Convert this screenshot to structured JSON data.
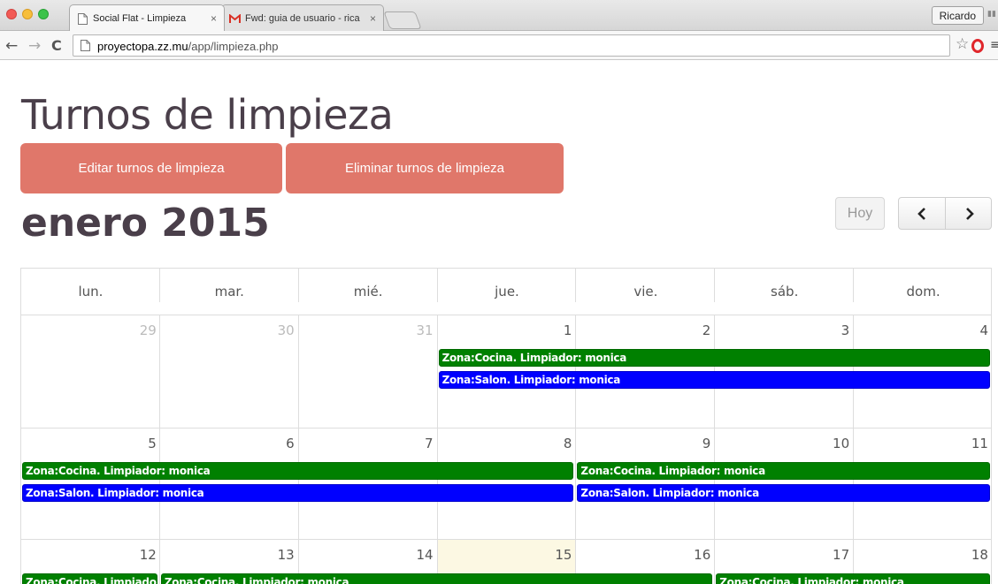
{
  "browser": {
    "tabs": [
      {
        "title": "Social Flat - Limpieza",
        "close": "×"
      },
      {
        "title": "Fwd: guia de usuario - rica",
        "close": "×"
      }
    ],
    "profile": "Ricardo",
    "url_host": "proyectopa.zz.mu",
    "url_path": "/app/limpieza.php",
    "nav_back": "←",
    "nav_forward": "→",
    "nav_reload": "C",
    "star_icon": "☆",
    "menu_icon": "≡"
  },
  "page": {
    "title": "Turnos de limpieza",
    "edit_button": "Editar turnos de limpieza",
    "delete_button": "Eliminar turnos de limpieza",
    "month": "enero 2015",
    "today_button": "Hoy",
    "prev_icon": "‹",
    "next_icon": "›",
    "button_color": "#e0776a",
    "cocina_color": "#008000",
    "salon_color": "#0000ff",
    "today_color": "#fcf8e3"
  },
  "calendar": {
    "weekdays": [
      "lun.",
      "mar.",
      "mié.",
      "jue.",
      "vie.",
      "sáb.",
      "dom."
    ],
    "weeks": [
      {
        "days": [
          "29",
          "30",
          "31",
          "1",
          "2",
          "3",
          "4"
        ],
        "other_month": [
          true,
          true,
          true,
          false,
          false,
          false,
          false
        ],
        "today": -1,
        "events": [
          {
            "label": "Zona:Cocina. Limpiador: monica",
            "type": "cocina",
            "start": 3,
            "end": 6,
            "lane": 0
          },
          {
            "label": "Zona:Salon. Limpiador: monica",
            "type": "salon",
            "start": 3,
            "end": 6,
            "lane": 1
          }
        ]
      },
      {
        "days": [
          "5",
          "6",
          "7",
          "8",
          "9",
          "10",
          "11"
        ],
        "other_month": [
          false,
          false,
          false,
          false,
          false,
          false,
          false
        ],
        "today": -1,
        "events": [
          {
            "label": "Zona:Cocina. Limpiador: monica",
            "type": "cocina",
            "start": 0,
            "end": 3,
            "lane": 0
          },
          {
            "label": "Zona:Salon. Limpiador: monica",
            "type": "salon",
            "start": 0,
            "end": 3,
            "lane": 1
          },
          {
            "label": "Zona:Cocina. Limpiador: monica",
            "type": "cocina",
            "start": 4,
            "end": 6,
            "lane": 0
          },
          {
            "label": "Zona:Salon. Limpiador: monica",
            "type": "salon",
            "start": 4,
            "end": 6,
            "lane": 1
          }
        ]
      },
      {
        "days": [
          "12",
          "13",
          "14",
          "15",
          "16",
          "17",
          "18"
        ],
        "other_month": [
          false,
          false,
          false,
          false,
          false,
          false,
          false
        ],
        "today": 3,
        "events": [
          {
            "label": "Zona:Cocina. Limpiador: monica",
            "type": "cocina",
            "start": 0,
            "end": 0,
            "lane": 0
          },
          {
            "label": "Zona:Cocina. Limpiador: monica",
            "type": "cocina",
            "start": 1,
            "end": 4,
            "lane": 0
          },
          {
            "label": "Zona:Cocina. Limpiador: monica",
            "type": "cocina",
            "start": 5,
            "end": 6,
            "lane": 0
          }
        ]
      }
    ]
  }
}
